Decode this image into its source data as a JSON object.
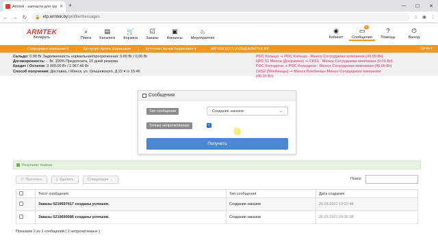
{
  "browser": {
    "tab_title": "Armtek - запчасти для грузовы...",
    "new_tab": "+",
    "win_min": "—",
    "win_max": "☐",
    "win_close": "✕",
    "url_host": "etp.armtek.by",
    "url_path": "/profile/messages"
  },
  "header": {
    "brand": "ARMTEK",
    "country": "Беларусь",
    "nav": [
      {
        "label": "Поиск",
        "icon": "search-icon"
      },
      {
        "label": "Каталоги",
        "icon": "catalog-icon"
      },
      {
        "label": "Корзина",
        "icon": "cart-icon"
      },
      {
        "label": "Заказы",
        "icon": "orders-icon"
      },
      {
        "label": "Финансы",
        "icon": "finance-icon"
      },
      {
        "label": "Мероприятия",
        "icon": "fire-icon"
      }
    ],
    "right_nav": [
      {
        "label": "Кабинет",
        "icon": "user-icon"
      },
      {
        "label": "Сообщения",
        "icon": "chat-icon",
        "badge": "2"
      },
      {
        "label": "Помощь",
        "icon": "help-icon"
      },
      {
        "label": "Выход",
        "icon": "power-icon"
      }
    ]
  },
  "orange_bar": {
    "items": [
      "Сотрудники компании К",
      "Кутлунин Артем Борисович",
      "Кутлунин Артем Борисович ▾",
      "ARTEM.KUTLUNIN@ARMTEK.BY"
    ],
    "price": "Цена ▾"
  },
  "info": {
    "left": [
      {
        "label": "Сальдо:",
        "value": " 0.00 Br   Задолженность нормальная/просроченная: 0.00 Br / 0.00 Br"
      },
      {
        "label": "Договоренность:",
        "value": " -. Br, 100% Предоплата, 10 дней резерва"
      },
      {
        "label": "Кредит / Остаток:",
        "value": " 3 000.00 Br / 2 967.46 Br"
      },
      {
        "label": "Способ получения:",
        "value": " Доставка, г.Минск, ул. Ольшевского, Д.22 ▾    ⊙ 15:46"
      }
    ],
    "right": [
      "РОС Кольцо ➔ РОС Кольцо - Минск Сотрудники компании (40.00 Br)",
      "ЦРС 51 Минск (Дзержино) ➔ СКS1 - Минск Сотрудники компании (0.01 Br)",
      "РОС Колодичи ➔ РОС Колодичи - Минск Сотрудники компании (40.00 Br)",
      "СКS2 (Плебанцы) ➔ Минск Плебанцы Минск Сотрудники компании",
      "(40.00 Br)"
    ]
  },
  "messages_panel": {
    "title": "Сообщения",
    "type_label": "Тип сообщение",
    "type_value": "Создание заказов",
    "unread_label": "Только непрочитанные",
    "unread_checked": true,
    "submit": "Получить"
  },
  "results": {
    "title": "Результат поиска",
    "buttons": [
      "Прочтано",
      "Удалить",
      "Следующие →"
    ],
    "search_label": "Поиск:",
    "columns": [
      "Текст сообщения",
      "Тип сообщения",
      "Дата создания"
    ],
    "rows": [
      {
        "text": "Заказы 0219697417 созданы успешно.",
        "type": "Создание заказов",
        "date": "26.03.2021 13:22:48"
      },
      {
        "text": "Заказы 0219690086 созданы успешно.",
        "type": "Создание заказов",
        "date": "26.03.2021 09:36:38"
      }
    ],
    "summary": "Показано 2 из 2 сообщений ( 2 непрочитанных )"
  }
}
